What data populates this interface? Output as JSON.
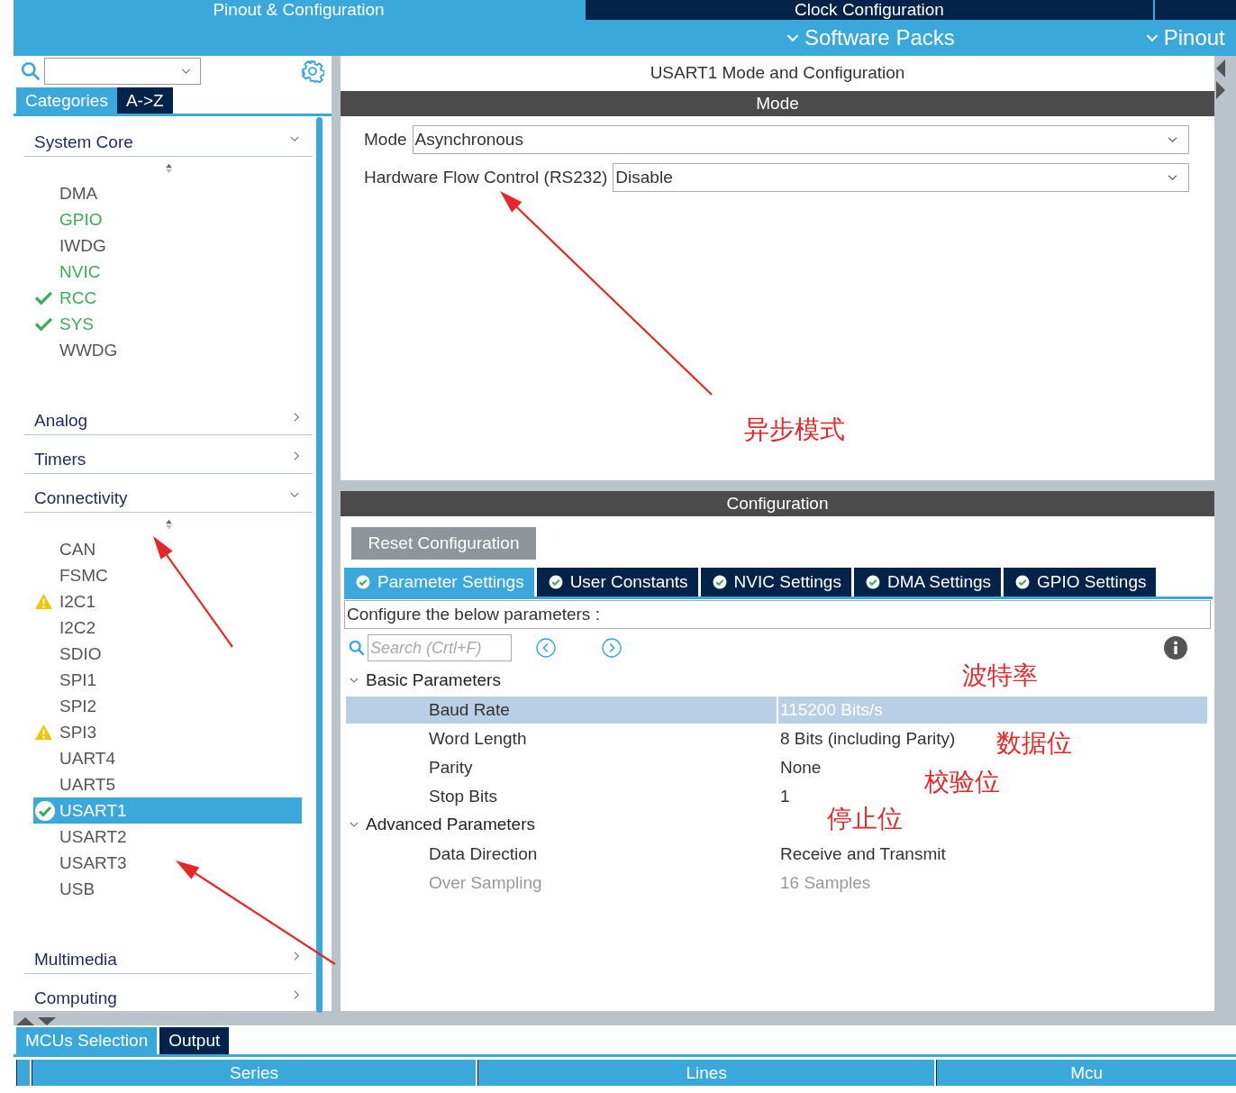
{
  "top_tabs": [
    {
      "label": "Pinout & Configuration",
      "selected": true
    },
    {
      "label": "Clock Configuration",
      "selected": false
    }
  ],
  "menus": [
    {
      "label": "Software Packs"
    },
    {
      "label": "Pinout"
    }
  ],
  "sidebar": {
    "tabs": [
      {
        "label": "Categories",
        "selected": true
      },
      {
        "label": "A->Z",
        "selected": false
      }
    ],
    "categories": [
      {
        "label": "System Core",
        "expanded": true,
        "children": [
          {
            "label": "DMA",
            "kind": "plain",
            "selected": false
          },
          {
            "label": "GPIO",
            "kind": "active",
            "selected": false
          },
          {
            "label": "IWDG",
            "kind": "plain",
            "selected": false
          },
          {
            "label": "NVIC",
            "kind": "active",
            "selected": false
          },
          {
            "label": "RCC",
            "kind": "checked",
            "selected": false
          },
          {
            "label": "SYS",
            "kind": "checked",
            "selected": false
          },
          {
            "label": "WWDG",
            "kind": "plain",
            "selected": false
          }
        ]
      },
      {
        "label": "Analog",
        "expanded": false
      },
      {
        "label": "Timers",
        "expanded": false
      },
      {
        "label": "Connectivity",
        "expanded": true,
        "children": [
          {
            "label": "CAN",
            "kind": "plain",
            "selected": false
          },
          {
            "label": "FSMC",
            "kind": "plain",
            "selected": false
          },
          {
            "label": "I2C1",
            "kind": "warning",
            "selected": false
          },
          {
            "label": "I2C2",
            "kind": "plain",
            "selected": false
          },
          {
            "label": "SDIO",
            "kind": "plain",
            "selected": false
          },
          {
            "label": "SPI1",
            "kind": "plain",
            "selected": false
          },
          {
            "label": "SPI2",
            "kind": "plain",
            "selected": false
          },
          {
            "label": "SPI3",
            "kind": "warning",
            "selected": false
          },
          {
            "label": "UART4",
            "kind": "plain",
            "selected": false
          },
          {
            "label": "UART5",
            "kind": "plain",
            "selected": false
          },
          {
            "label": "USART1",
            "kind": "checked",
            "selected": true
          },
          {
            "label": "USART2",
            "kind": "plain",
            "selected": false
          },
          {
            "label": "USART3",
            "kind": "plain",
            "selected": false
          },
          {
            "label": "USB",
            "kind": "plain",
            "selected": false
          }
        ]
      },
      {
        "label": "Multimedia",
        "expanded": false
      },
      {
        "label": "Computing",
        "expanded": false
      }
    ]
  },
  "mode_panel": {
    "title": "USART1 Mode and Configuration",
    "header": "Mode",
    "fields": [
      {
        "label": "Mode",
        "value": "Asynchronous"
      },
      {
        "label": "Hardware Flow Control (RS232)",
        "value": "Disable"
      }
    ]
  },
  "config_panel": {
    "header": "Configuration",
    "reset_button": "Reset Configuration",
    "tabs": [
      {
        "label": "Parameter Settings",
        "selected": true
      },
      {
        "label": "User Constants",
        "selected": false
      },
      {
        "label": "NVIC Settings",
        "selected": false
      },
      {
        "label": "DMA Settings",
        "selected": false
      },
      {
        "label": "GPIO Settings",
        "selected": false
      }
    ],
    "hint": "Configure the below parameters :",
    "search": {
      "placeholder": "Search (Crtl+F)"
    },
    "groups": [
      {
        "label": "Basic Parameters",
        "expanded": true,
        "children": [
          {
            "label": "Baud Rate",
            "value": "115200 Bits/s",
            "selected": true,
            "disabled": false
          },
          {
            "label": "Word Length",
            "value": "8 Bits (including Parity)",
            "selected": false,
            "disabled": false
          },
          {
            "label": "Parity",
            "value": "None",
            "selected": false,
            "disabled": false
          },
          {
            "label": "Stop Bits",
            "value": "1",
            "selected": false,
            "disabled": false
          }
        ]
      },
      {
        "label": "Advanced Parameters",
        "expanded": true,
        "children": [
          {
            "label": "Data Direction",
            "value": "Receive and Transmit",
            "selected": false,
            "disabled": false
          },
          {
            "label": "Over Sampling",
            "value": "16 Samples",
            "selected": false,
            "disabled": true
          }
        ]
      }
    ]
  },
  "annotations": [
    {
      "text": "异步模式"
    },
    {
      "text": "波特率"
    },
    {
      "text": "数据位"
    },
    {
      "text": "校验位"
    },
    {
      "text": "停止位"
    }
  ],
  "bottom_tabs": [
    {
      "label": "MCUs Selection",
      "selected": true
    },
    {
      "label": "Output",
      "selected": false
    }
  ],
  "table": {
    "columns": [
      "Series",
      "Lines",
      "Mcu"
    ]
  }
}
